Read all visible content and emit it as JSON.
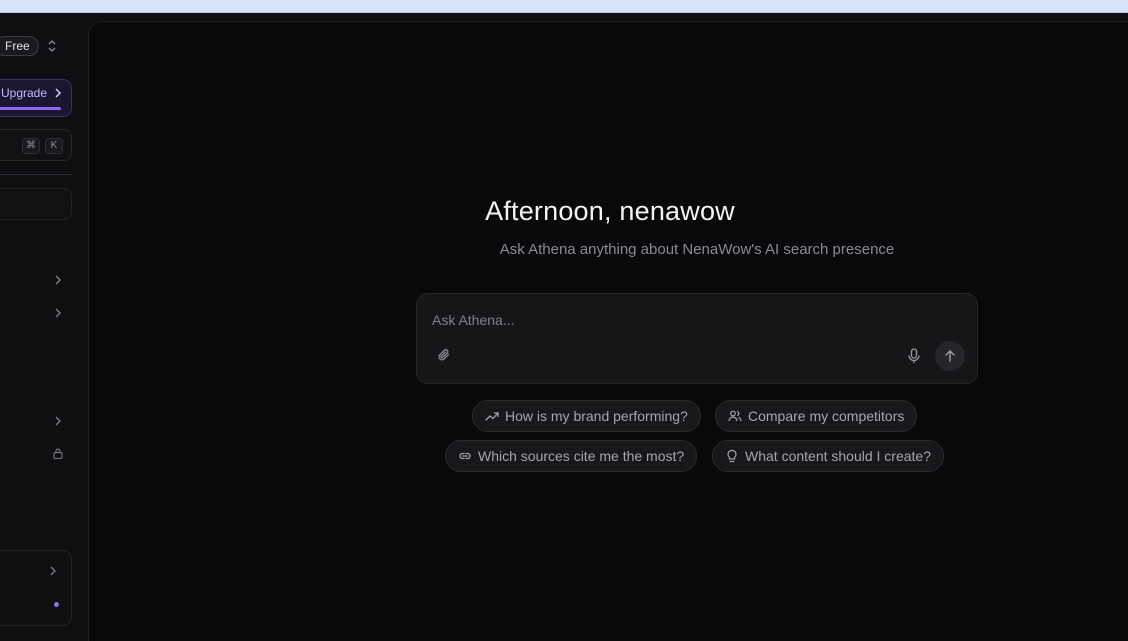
{
  "sidebar": {
    "plan_badge": "Free",
    "upgrade_label": "Upgrade",
    "shortcut_keys": [
      "⌘",
      "K"
    ]
  },
  "main": {
    "greeting": "Afternoon, nenawow",
    "subtitle": "Ask Athena anything about NenaWow's AI search presence",
    "chat": {
      "placeholder": "Ask Athena..."
    },
    "suggestions": [
      {
        "icon": "trending-up-icon",
        "label": "How is my brand performing?"
      },
      {
        "icon": "users-icon",
        "label": "Compare my competitors"
      },
      {
        "icon": "link-icon",
        "label": "Which sources cite me the most?"
      },
      {
        "icon": "lightbulb-icon",
        "label": "What content should I create?"
      }
    ]
  },
  "colors": {
    "accent": "#8c6cf5",
    "background": "#09090b",
    "sidebar_background": "#0f0f11"
  }
}
